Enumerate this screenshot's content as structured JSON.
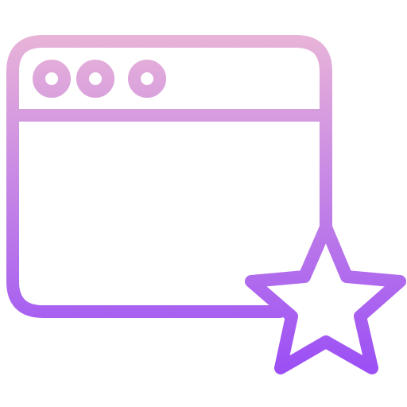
{
  "icon": {
    "name": "browser-window-star-icon",
    "gradient_top": "#E8B4D8",
    "gradient_bottom": "#9B4FF5"
  }
}
